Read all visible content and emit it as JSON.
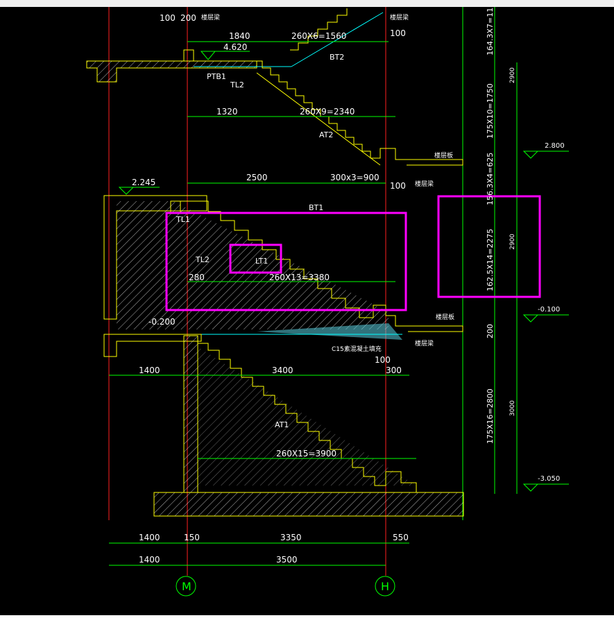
{
  "colors": {
    "background": "#000000",
    "axis_red": "#ff2020",
    "dimension_green": "#00ff00",
    "structure_yellow": "#ffff00",
    "text_white": "#ffffff",
    "magenta_highlight": "#ff00ff",
    "cyan_line": "#00ffff"
  },
  "top": {
    "dim_100": "100",
    "dim_200": "200",
    "note_1": "楼层梁",
    "dim_1840": "1840",
    "dim_260x6": "260X6=1560",
    "note_2": "楼层梁",
    "dim_100_right": "100",
    "elev_4620": "4.620",
    "label_bt2": "BT2",
    "label_ptb1": "PTB1",
    "label_tl2": "TL2"
  },
  "upper_flight": {
    "dim_1320": "1320",
    "dim_260x9": "260X9=2340",
    "label_at2": "AT2",
    "note_slab": "楼层板",
    "elev_2800": "2.800"
  },
  "middle": {
    "dim_2500": "2500",
    "dim_300x3": "300x3=900",
    "dim_100": "100",
    "note_beam": "楼层梁",
    "elev_2245": "2.245",
    "label_bt1": "BT1",
    "label_tl1": "TL1",
    "label_tl2": "TL2",
    "label_lt1": "LT1",
    "dim_280": "280",
    "dim_260x13": "260X13=3380",
    "elev_m0200": "-0.200",
    "note_slab": "楼层板",
    "note_beam_low": "楼层梁",
    "note_concrete": "C15素混凝土填充",
    "elev_m0100": "-0.100"
  },
  "lower": {
    "dim_100": "100",
    "dim_1400": "1400",
    "dim_3400": "3400",
    "dim_300": "300",
    "label_at1": "AT1",
    "dim_260x15": "260X15=3900",
    "elev_m3050": "-3.050"
  },
  "right_dims": {
    "d1": "164.3X7=11",
    "d2": "175X10=1750",
    "d3": "2900",
    "d4": "156.3X4=625",
    "d5": "162.5X14=2275",
    "d6": "2900",
    "d7": "200",
    "d8": "175X16=2800",
    "d9": "3000"
  },
  "bottom": {
    "d_1400a": "1400",
    "d_150": "150",
    "d_3350": "3350",
    "d_550": "550",
    "d_1400b": "1400",
    "d_3500": "3500",
    "axis_m": "M",
    "axis_h": "H"
  }
}
